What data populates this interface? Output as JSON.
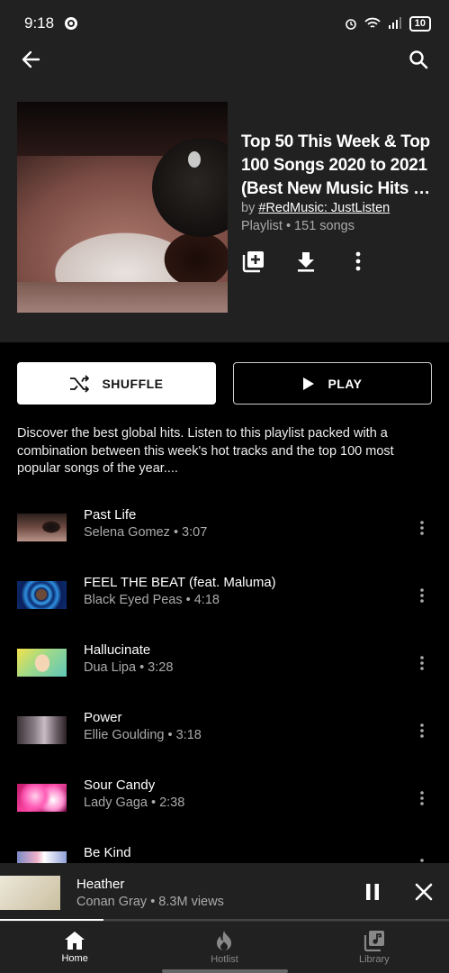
{
  "status_bar": {
    "time": "9:18",
    "battery": "10"
  },
  "nav": {
    "back_icon": "arrow-back-icon",
    "search_icon": "search-icon"
  },
  "playlist": {
    "title_lines": [
      "Top 50 This Week & Top",
      "100 Songs 2020 to 2021",
      "(Best New Music Hits Pl..."
    ],
    "by_prefix": "by ",
    "author": "#RedMusic: JustListen",
    "meta": "Playlist • 151 songs",
    "actions": [
      "add-to-library-icon",
      "download-icon",
      "more-vert-icon"
    ],
    "description": "Discover the best global hits. Listen to this playlist packed with a combination between this week's hot tracks and the top 100 most popular songs of the year...."
  },
  "buttons": {
    "shuffle": "SHUFFLE",
    "play": "PLAY"
  },
  "tracks": [
    {
      "title": "Past Life",
      "subtitle": "Selena Gomez • 3:07"
    },
    {
      "title": "FEEL THE BEAT (feat. Maluma)",
      "subtitle": "Black Eyed Peas • 4:18"
    },
    {
      "title": "Hallucinate",
      "subtitle": "Dua Lipa • 3:28"
    },
    {
      "title": "Power",
      "subtitle": "Ellie Goulding • 3:18"
    },
    {
      "title": "Sour Candy",
      "subtitle": "Lady Gaga • 2:38"
    },
    {
      "title": "Be Kind",
      "subtitle": ""
    }
  ],
  "mini_player": {
    "title": "Heather",
    "subtitle": "Conan Gray • 8.3M views",
    "progress": 0.23
  },
  "bottom_nav": [
    {
      "label": "Home",
      "icon": "home-icon",
      "active": true
    },
    {
      "label": "Hotlist",
      "icon": "fire-icon",
      "active": false
    },
    {
      "label": "Library",
      "icon": "library-music-icon",
      "active": false
    }
  ],
  "colors": {
    "header_bg": "#212121",
    "page_bg": "#000000",
    "secondary_text": "#aaaaaa"
  }
}
